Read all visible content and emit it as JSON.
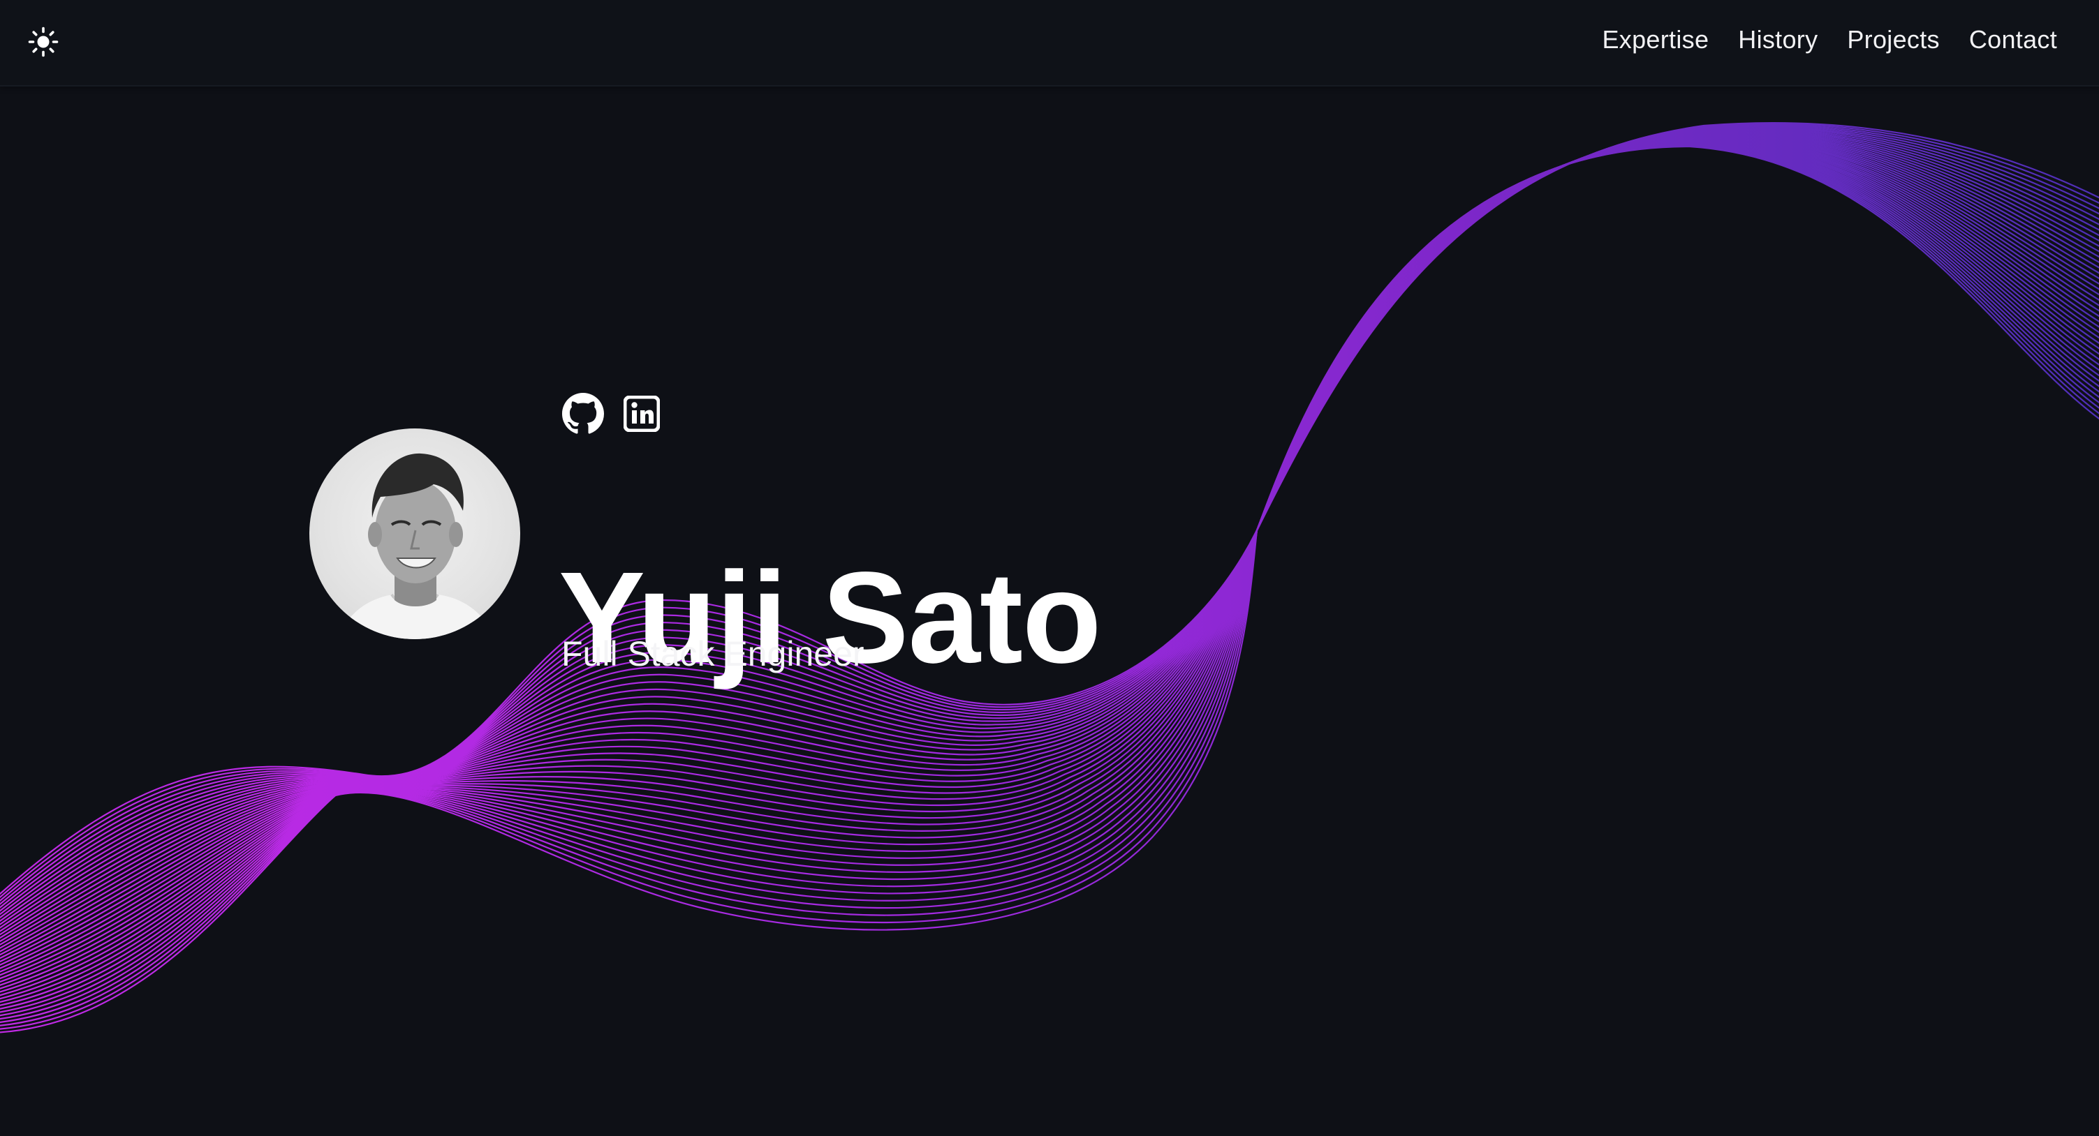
{
  "header": {
    "theme_toggle_icon": "sun-icon",
    "nav": [
      {
        "label": "Expertise"
      },
      {
        "label": "History"
      },
      {
        "label": "Projects"
      },
      {
        "label": "Contact"
      }
    ]
  },
  "hero": {
    "social": [
      {
        "icon": "github-icon"
      },
      {
        "icon": "linkedin-icon"
      }
    ],
    "avatar_icon": "profile-photo",
    "name": "Yuji Sato",
    "title": "Full Stack Engineer"
  },
  "theme": {
    "background": "#0e1016",
    "wave_start": "#c026e8",
    "wave_end": "#5a2bd6"
  }
}
